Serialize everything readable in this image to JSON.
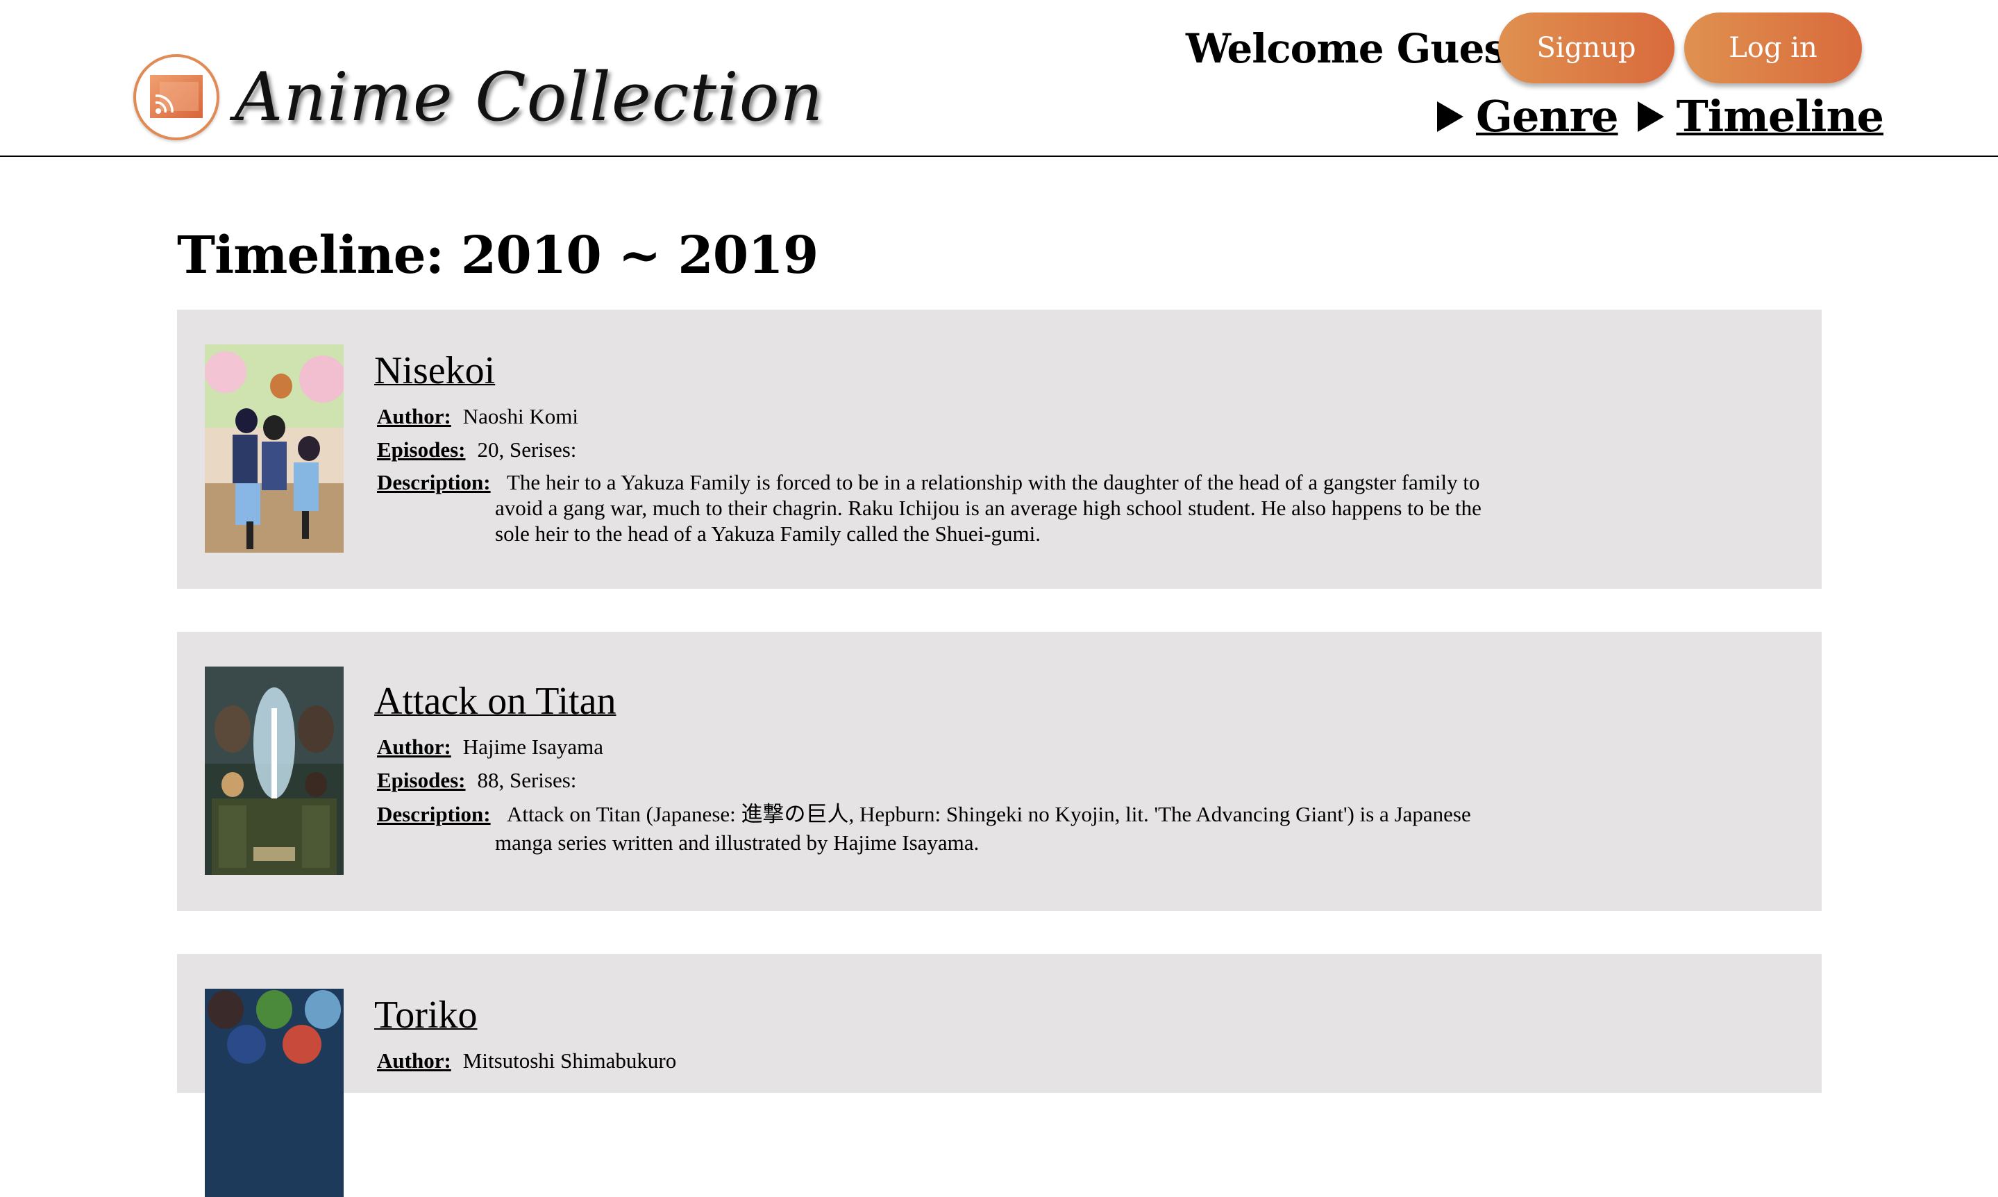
{
  "header": {
    "site_title": "Anime Collection",
    "logo_icon": "rss-screen-icon",
    "welcome_text": "Welcome Guest",
    "signup_label": "Signup",
    "login_label": "Log in",
    "nav": [
      {
        "label": "Genre",
        "icon": "triangle-right-icon"
      },
      {
        "label": "Timeline",
        "icon": "triangle-right-icon"
      }
    ],
    "accent_color": "#db7a45"
  },
  "main": {
    "heading": "Timeline: 2010 ~ 2019",
    "labels": {
      "author": "Author:",
      "episodes": "Episodes:",
      "description": "Description:"
    },
    "animes": [
      {
        "title": "Nisekoi",
        "author": "Naoshi Komi",
        "episodes": "20, Serises:",
        "description": "The heir to a Yakuza Family is forced to be in a relationship with the daughter of the head of a gangster family to avoid a gang war, much to their chagrin. Raku Ichijou is an average high school student. He also happens to be the sole heir to the head of a Yakuza Family called the Shuei-gumi."
      },
      {
        "title": "Attack on Titan",
        "author": "Hajime Isayama",
        "episodes": "88, Serises:",
        "description": "Attack on Titan (Japanese: 進撃の巨人, Hepburn: Shingeki no Kyojin, lit. 'The Advancing Giant') is a Japanese manga series written and illustrated by Hajime Isayama."
      },
      {
        "title": "Toriko",
        "author": "Mitsutoshi Shimabukuro",
        "episodes": "",
        "description": ""
      }
    ]
  }
}
